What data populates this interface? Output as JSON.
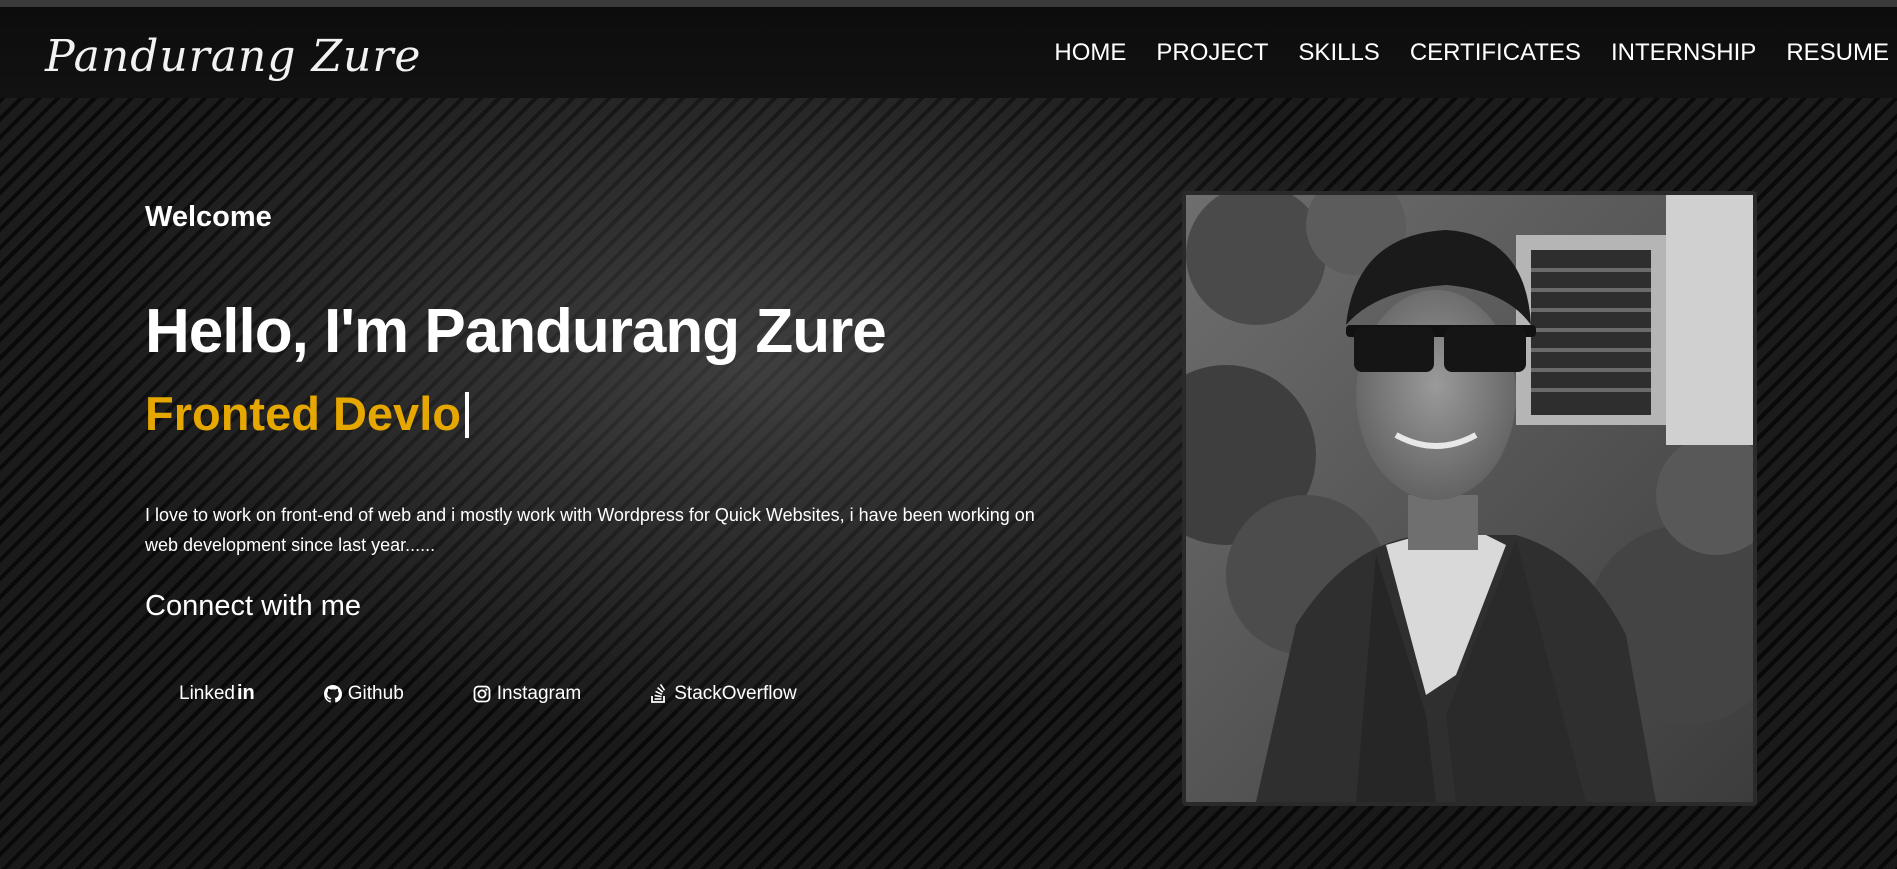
{
  "brand": {
    "name": "Pandurang Zure"
  },
  "nav": {
    "items": [
      {
        "label": "HOME"
      },
      {
        "label": "PROJECT"
      },
      {
        "label": "SKILLS"
      },
      {
        "label": "CERTIFICATES"
      },
      {
        "label": "INTERNSHIP"
      },
      {
        "label": "RESUME"
      }
    ]
  },
  "hero": {
    "welcome": "Welcome",
    "headline": "Hello, I'm Pandurang Zure",
    "role_typed": "Fronted Devlo",
    "intro": "I love to work on front-end of web and i mostly work with Wordpress for Quick Websites, i have been working on web development since last year......",
    "connect_heading": "Connect with me",
    "accent_color": "#e6a800"
  },
  "socials": [
    {
      "label": "Linked",
      "suffix": "in",
      "icon": "linkedin-icon"
    },
    {
      "label": "Github",
      "icon": "github-icon"
    },
    {
      "label": "Instagram",
      "icon": "instagram-icon"
    },
    {
      "label": "StackOverflow",
      "icon": "stackoverflow-icon"
    }
  ]
}
